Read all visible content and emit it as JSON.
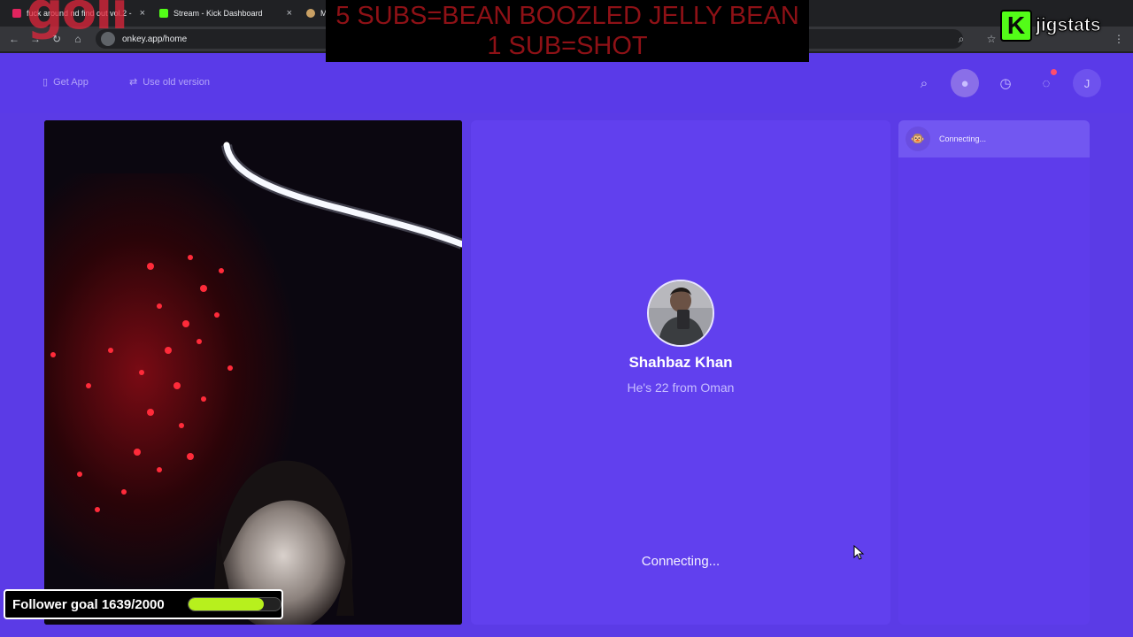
{
  "browser": {
    "tabs": [
      {
        "label": "fuck around nd find out vol.2 -",
        "close": "×",
        "favicon_color": "#e0245e"
      },
      {
        "label": "Stream - Kick Dashboard",
        "close": "×",
        "favicon_color": "#53fc18"
      },
      {
        "label": "M",
        "close": "",
        "favicon_color": "#c9a064"
      }
    ],
    "url": "onkey.app/home"
  },
  "overlay": {
    "banner_line1": "5 SUBS=BEAN BOOZLED JELLY BEAN",
    "banner_line2": "1 SUB=SHOT",
    "brand_text": "jigstats",
    "brand_k": "K",
    "follower_goal": {
      "label": "Follower goal 1639/2000",
      "current": 1639,
      "target": 2000
    }
  },
  "site": {
    "logo": "goli",
    "header_links": {
      "get_app": "Get App",
      "old_version": "Use old version"
    },
    "user_initial": "J",
    "notification_count": "1"
  },
  "match": {
    "name": "Shahbaz Khan",
    "info": "He's 22 from Oman",
    "status": "Connecting..."
  },
  "chat": {
    "status": "Connecting..."
  },
  "colors": {
    "page_bg": "#5b3be6",
    "panel_bg": "#6140ee",
    "goal_fill": "#b7f01d",
    "kick_green": "#53fc18",
    "banner_text": "#8e1116"
  }
}
